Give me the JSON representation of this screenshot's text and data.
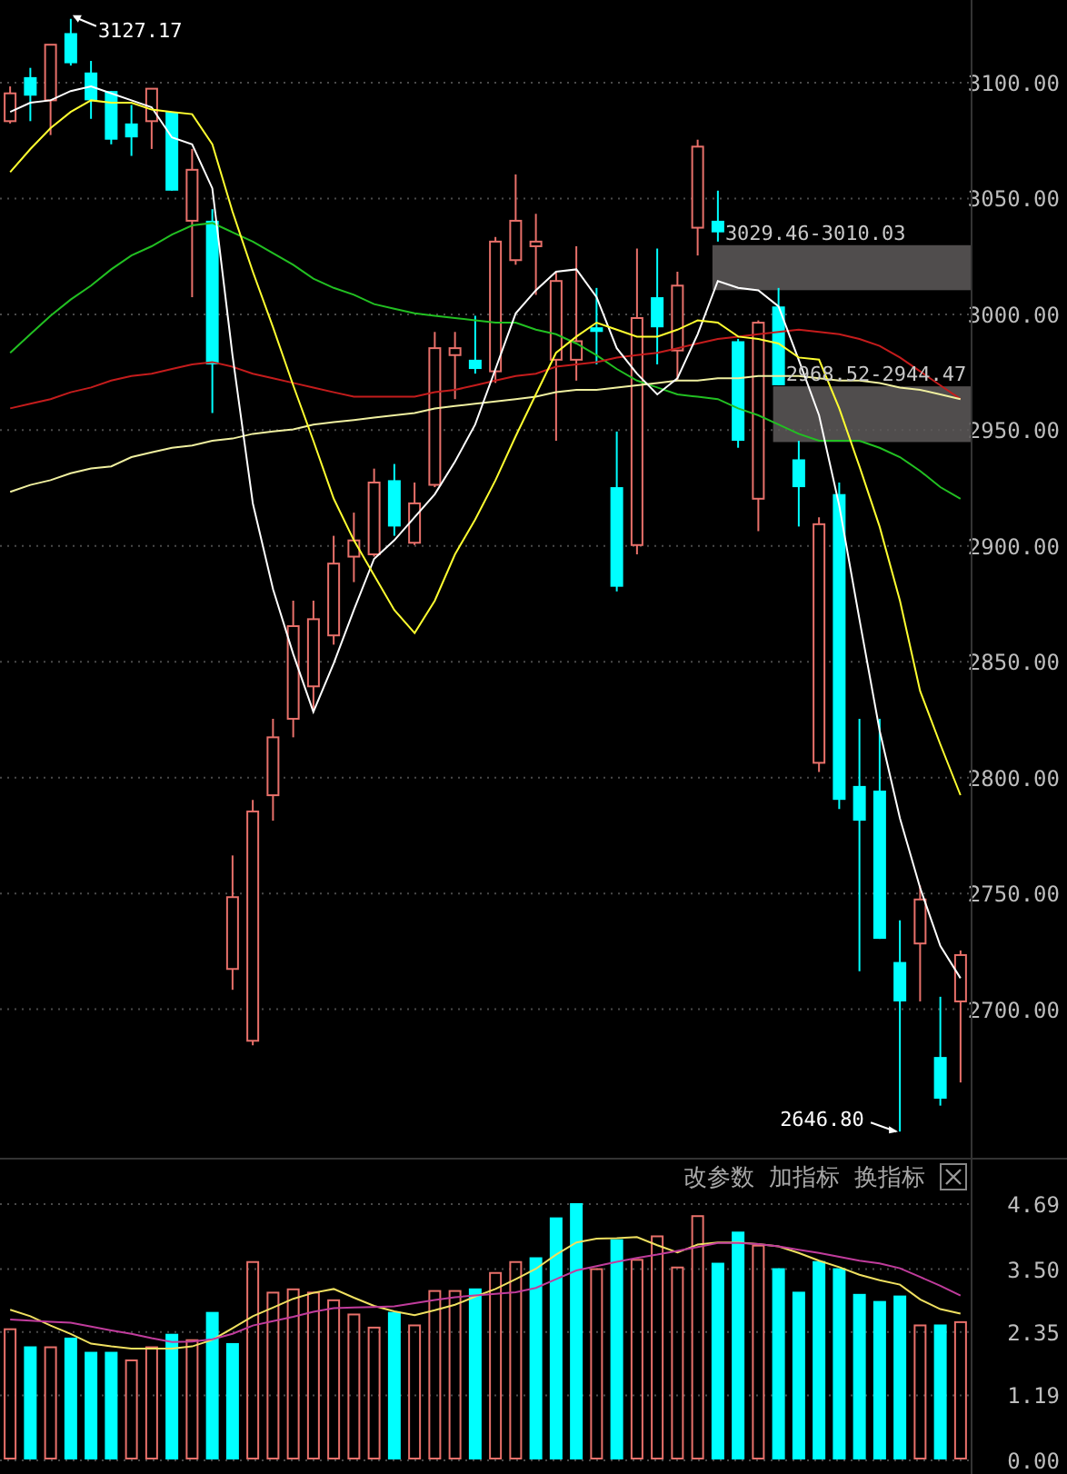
{
  "price_panel": {
    "chart_data": {
      "type": "candlestick",
      "grid": true,
      "ylim": [
        2635.5,
        3135.3
      ],
      "yticks": [
        {
          "value": 3100,
          "label": "3100.00"
        },
        {
          "value": 3050,
          "label": "3050.00"
        },
        {
          "value": 3000,
          "label": "3000.00"
        },
        {
          "value": 2950,
          "label": "2950.00"
        },
        {
          "value": 2900,
          "label": "2900.00"
        },
        {
          "value": 2850,
          "label": "2850.00"
        },
        {
          "value": 2800,
          "label": "2800.00"
        },
        {
          "value": 2750,
          "label": "2750.00"
        },
        {
          "value": 2700,
          "label": "2700.00"
        }
      ],
      "categories": [
        null,
        null,
        null,
        null,
        null,
        null,
        null,
        null,
        null,
        null,
        null,
        null,
        null,
        null,
        null,
        null,
        null,
        null,
        null,
        null,
        null,
        null,
        null,
        null,
        null,
        null,
        null,
        null,
        null,
        null,
        null,
        null,
        null,
        null,
        null,
        null,
        null,
        null,
        null,
        null,
        null,
        null,
        null,
        null,
        null,
        null,
        null,
        null
      ],
      "ohlc": [
        [
          3083,
          3098,
          3082,
          3095
        ],
        [
          3102,
          3106,
          3083,
          3094
        ],
        [
          3092,
          3116,
          3077,
          3116
        ],
        [
          3121,
          3127.17,
          3107,
          3108
        ],
        [
          3104,
          3109,
          3084,
          3092
        ],
        [
          3096,
          3096,
          3073,
          3075
        ],
        [
          3082,
          3090,
          3068,
          3076
        ],
        [
          3083,
          3097,
          3071,
          3097
        ],
        [
          3087,
          3087,
          3053,
          3053
        ],
        [
          3040,
          3071,
          3007,
          3062
        ],
        [
          3040,
          3045,
          2957,
          2978
        ],
        [
          2717,
          2766,
          2708,
          2748
        ],
        [
          2686,
          2790,
          2684,
          2785
        ],
        [
          2792,
          2825,
          2781,
          2817
        ],
        [
          2825,
          2876,
          2817,
          2865
        ],
        [
          2839,
          2876,
          2828,
          2868
        ],
        [
          2861,
          2904,
          2857,
          2892
        ],
        [
          2895,
          2914,
          2884,
          2902
        ],
        [
          2896,
          2933,
          2895,
          2927
        ],
        [
          2928,
          2935,
          2904,
          2908
        ],
        [
          2901,
          2927,
          2900,
          2918
        ],
        [
          2926,
          2992,
          2925,
          2985
        ],
        [
          2982,
          2992,
          2963,
          2985
        ],
        [
          2980,
          2999,
          2974,
          2976
        ],
        [
          2975,
          3033,
          2970,
          3031
        ],
        [
          3023,
          3060,
          3021,
          3040
        ],
        [
          3029,
          3043,
          3008,
          3031
        ],
        [
          2980,
          3018,
          2945,
          3014
        ],
        [
          2980,
          3029,
          2971,
          2988
        ],
        [
          2994,
          3011,
          2978,
          2992
        ],
        [
          2925,
          2949,
          2880,
          2882
        ],
        [
          2900,
          3028,
          2896,
          2998
        ],
        [
          3007,
          3028,
          2978,
          2994
        ],
        [
          2984,
          3018,
          2971,
          3012
        ],
        [
          3037,
          3075,
          3025,
          3072
        ],
        [
          3040,
          3053,
          3031,
          3035
        ],
        [
          2988,
          2989,
          2942,
          2945
        ],
        [
          2920,
          2997,
          2906,
          2996
        ],
        [
          3003,
          3011,
          2969,
          2969
        ],
        [
          2937,
          2945,
          2908,
          2925
        ],
        [
          2806,
          2912,
          2802,
          2909
        ],
        [
          2922,
          2927,
          2786,
          2790
        ],
        [
          2796,
          2825,
          2716,
          2781
        ],
        [
          2794,
          2825,
          2730,
          2730
        ],
        [
          2720,
          2738,
          2646.8,
          2703
        ],
        [
          2728,
          2753,
          2703,
          2747
        ],
        [
          2679,
          2705,
          2658,
          2661
        ],
        [
          2703,
          2725,
          2668,
          2723
        ]
      ],
      "series": [
        {
          "type": "line",
          "color": "#22c022",
          "values": [
            2983,
            2991,
            2999,
            3006,
            3012,
            3019,
            3025,
            3029,
            3034,
            3038,
            3039,
            3035,
            3031,
            3026,
            3021,
            3015,
            3011,
            3008,
            3004,
            3002,
            3000,
            2999,
            2998,
            2997,
            2996,
            2996,
            2993,
            2991,
            2987,
            2982,
            2976,
            2971,
            2968,
            2965,
            2964,
            2963,
            2959,
            2956,
            2952,
            2948,
            2945,
            2945,
            2945,
            2942,
            2938,
            2932,
            2925,
            2920
          ]
        },
        {
          "type": "line",
          "color": "#c41c1c",
          "values": [
            2959,
            2961,
            2963,
            2966,
            2968,
            2971,
            2973,
            2974,
            2976,
            2978,
            2979,
            2977,
            2974,
            2972,
            2970,
            2968,
            2966,
            2964,
            2964,
            2964,
            2964,
            2966,
            2967,
            2969,
            2971,
            2973,
            2974,
            2977,
            2978,
            2979,
            2981,
            2982,
            2983,
            2985,
            2987,
            2989,
            2990,
            2991,
            2992,
            2993,
            2992,
            2991,
            2989,
            2986,
            2981,
            2975,
            2969,
            2963
          ]
        },
        {
          "type": "line",
          "color": "#f0f0a0",
          "values": [
            2923,
            2926,
            2928,
            2931,
            2933,
            2934,
            2938,
            2940,
            2942,
            2943,
            2945,
            2946,
            2948,
            2949,
            2950,
            2952,
            2953,
            2954,
            2955,
            2956,
            2957,
            2959,
            2960,
            2961,
            2962,
            2963,
            2964,
            2966,
            2967,
            2967,
            2968,
            2969,
            2970,
            2971,
            2971,
            2972,
            2972,
            2973,
            2973,
            2973,
            2972,
            2971,
            2971,
            2970,
            2968,
            2967,
            2965,
            2963
          ]
        },
        {
          "type": "line",
          "color": "#ffffff",
          "values": [
            3087,
            3091,
            3092,
            3096,
            3098,
            3095,
            3092,
            3089,
            3076,
            3073,
            3054,
            2982,
            2918,
            2881,
            2853,
            2828,
            2849,
            2872,
            2894,
            2902,
            2912,
            2922,
            2936,
            2952,
            2976,
            3000,
            3010,
            3018,
            3019,
            3007,
            2985,
            2974,
            2965,
            2972,
            2991,
            3014,
            3011,
            3010,
            3003,
            2980,
            2956,
            2917,
            2868,
            2820,
            2782,
            2752,
            2727,
            2713
          ]
        },
        {
          "type": "line",
          "color": "#ffff30",
          "values": [
            3061,
            3071,
            3080,
            3087,
            3092,
            3091,
            3091,
            3088,
            3087,
            3086,
            3073,
            3044,
            3018,
            2994,
            2969,
            2945,
            2920,
            2902,
            2887,
            2872,
            2862,
            2876,
            2896,
            2911,
            2928,
            2947,
            2965,
            2983,
            2990,
            2996,
            2993,
            2990,
            2990,
            2993,
            2997,
            2996,
            2990,
            2989,
            2987,
            2981,
            2980,
            2959,
            2934,
            2908,
            2876,
            2837,
            2814,
            2792
          ]
        }
      ],
      "bands": [
        {
          "axis": "y",
          "from": 3010.03,
          "to": 3029.46
        },
        {
          "axis": "y",
          "from": 2944.47,
          "to": 2968.52
        }
      ],
      "annotations": [
        "3127.17",
        "3029.46-3010.03",
        "2968.52-2944.47",
        "2646.80"
      ]
    }
  },
  "volume_panel": {
    "toolbar": {
      "buttons": [
        "改参数",
        "加指标",
        "换指标"
      ]
    },
    "chart_data": {
      "type": "bar",
      "grid": true,
      "ylim": [
        0,
        4.69
      ],
      "yticks": [
        {
          "value": 4.69,
          "label": "4.69"
        },
        {
          "value": 3.5,
          "label": "3.50"
        },
        {
          "value": 2.35,
          "label": "2.35"
        },
        {
          "value": 1.19,
          "label": "1.19"
        },
        {
          "value": 0,
          "label": "0.00"
        }
      ],
      "series": [
        {
          "color": "#e8706a",
          "values": [
            2.4,
            null,
            2.07,
            null,
            null,
            null,
            1.83,
            2.07,
            null,
            2.2,
            null,
            null,
            3.63,
            3.07,
            3.13,
            3.07,
            2.93,
            2.67,
            2.43,
            null,
            2.47,
            3.1,
            3.1,
            null,
            3.43,
            3.63,
            null,
            null,
            null,
            3.5,
            null,
            3.67,
            4.1,
            3.53,
            4.47,
            null,
            null,
            3.93,
            null,
            null,
            null,
            null,
            null,
            null,
            null,
            2.47,
            null,
            2.53
          ]
        },
        {
          "color": "#00ffff",
          "values": [
            null,
            2.07,
            null,
            2.23,
            1.97,
            1.97,
            null,
            null,
            2.3,
            null,
            2.7,
            2.13,
            null,
            null,
            null,
            null,
            null,
            null,
            null,
            2.7,
            null,
            null,
            null,
            3.13,
            null,
            null,
            3.7,
            4.43,
            4.69,
            null,
            4.03,
            null,
            null,
            null,
            null,
            3.6,
            4.17,
            null,
            3.5,
            3.07,
            3.63,
            3.5,
            3.03,
            2.9,
            3.0,
            null,
            2.47,
            null
          ]
        },
        {
          "type": "line",
          "color": "#f0e060",
          "values": [
            2.74,
            2.62,
            2.45,
            2.3,
            2.12,
            2.07,
            2.03,
            2.03,
            2.03,
            2.07,
            2.19,
            2.4,
            2.62,
            2.78,
            2.94,
            3.05,
            3.12,
            2.96,
            2.81,
            2.71,
            2.64,
            2.73,
            2.83,
            2.98,
            3.12,
            3.3,
            3.49,
            3.75,
            3.97,
            4.04,
            4.05,
            4.07,
            3.92,
            3.79,
            3.93,
            3.97,
            3.97,
            3.94,
            3.9,
            3.78,
            3.64,
            3.52,
            3.38,
            3.28,
            3.2,
            2.93,
            2.75,
            2.67
          ]
        },
        {
          "type": "line",
          "color": "#c03c9c",
          "values": [
            2.56,
            2.54,
            2.52,
            2.5,
            2.43,
            2.36,
            2.3,
            2.22,
            2.15,
            2.16,
            2.2,
            2.3,
            2.45,
            2.53,
            2.61,
            2.7,
            2.77,
            2.78,
            2.79,
            2.8,
            2.86,
            2.92,
            2.97,
            3.0,
            3.03,
            3.06,
            3.14,
            3.3,
            3.46,
            3.54,
            3.62,
            3.69,
            3.75,
            3.82,
            3.89,
            3.96,
            3.96,
            3.94,
            3.9,
            3.84,
            3.78,
            3.71,
            3.64,
            3.59,
            3.5,
            3.34,
            3.18,
            3.0
          ]
        }
      ]
    }
  }
}
